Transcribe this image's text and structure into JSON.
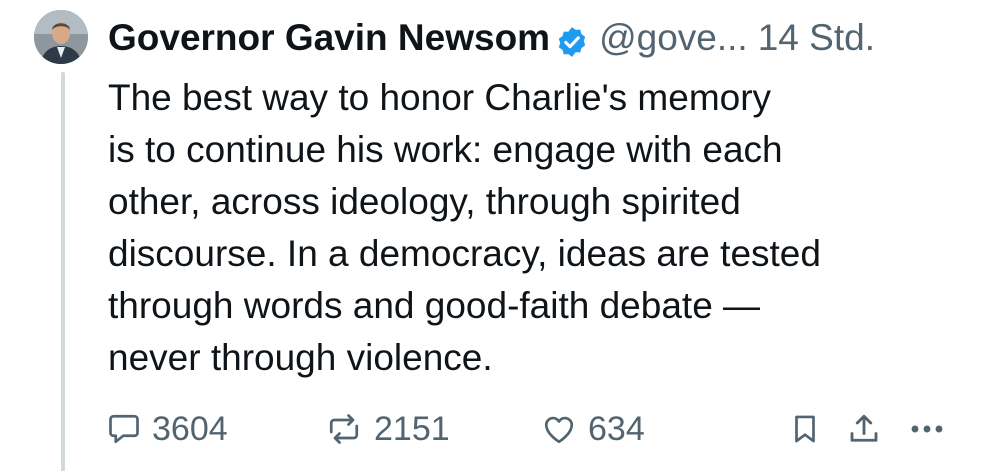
{
  "author": {
    "name": "Governor Gavin Newsom",
    "handle": "@gove...",
    "timestamp": "14 Std."
  },
  "tweet": {
    "lines": [
      "The best way to honor Charlie's memory",
      "is to continue his work: engage with each",
      "other, across ideology, through spirited",
      "discourse. In a democracy, ideas are tested",
      "through words and good-faith debate —",
      "never through violence."
    ]
  },
  "actions": {
    "replies": "3604",
    "reposts": "2151",
    "likes": "634"
  },
  "icons": {
    "verified": "verified-badge-icon",
    "reply": "reply-icon",
    "repost": "repost-icon",
    "like": "heart-icon",
    "bookmark": "bookmark-icon",
    "share": "share-icon",
    "more": "more-icon"
  },
  "colors": {
    "verified_blue": "#1d9bf0",
    "secondary_text": "#536471",
    "primary_text": "#0f1419",
    "thread_line": "#cfd9de"
  }
}
